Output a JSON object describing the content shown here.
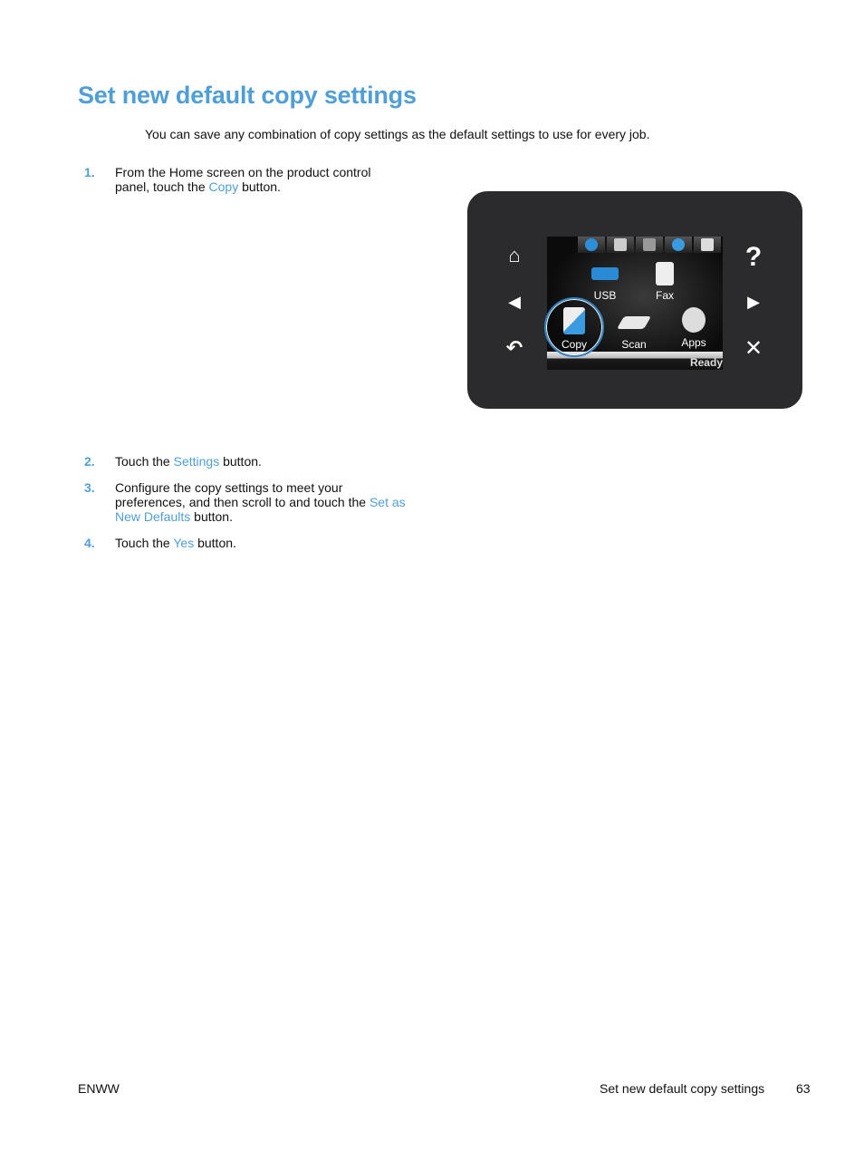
{
  "page": {
    "title": "Set new default copy settings",
    "intro": "You can save any combination of copy settings as the default settings to use for every job."
  },
  "steps": [
    {
      "num": "1.",
      "pre": "From the Home screen on the product control panel, touch the ",
      "link": "Copy",
      "post": " button."
    },
    {
      "num": "2.",
      "pre": "Touch the ",
      "link": "Settings",
      "post": " button."
    },
    {
      "num": "3.",
      "pre": "Configure the copy settings to meet your preferences, and then scroll to and touch the ",
      "link": "Set as New Defaults",
      "post": " button."
    },
    {
      "num": "4.",
      "pre": "Touch the ",
      "link": "Yes",
      "post": " button."
    }
  ],
  "control_panel": {
    "left_buttons": [
      "home-icon",
      "back-arrow-icon",
      "return-icon"
    ],
    "right_buttons": [
      "help-icon",
      "forward-arrow-icon",
      "cancel-icon"
    ],
    "top_icons": [
      "web-services-icon",
      "setup-icon",
      "wireless-icon",
      "hp-eprint-icon",
      "supplies-icon"
    ],
    "apps": [
      {
        "label": "USB",
        "icon": "usb-icon"
      },
      {
        "label": "Fax",
        "icon": "fax-icon"
      },
      {
        "label": "Copy",
        "icon": "copy-icon"
      },
      {
        "label": "Scan",
        "icon": "scan-icon"
      },
      {
        "label": "Apps",
        "icon": "apps-icon"
      }
    ],
    "status": "Ready",
    "glyphs": {
      "home": "⌂",
      "back": "◀",
      "return": "↶",
      "help": "?",
      "forward": "▶",
      "cancel": "✕"
    }
  },
  "footer": {
    "left": "ENWW",
    "section": "Set new default copy settings",
    "page_number": "63"
  },
  "colors": {
    "accent": "#4f9fd6",
    "highlight_ring": "#2f83c3"
  }
}
